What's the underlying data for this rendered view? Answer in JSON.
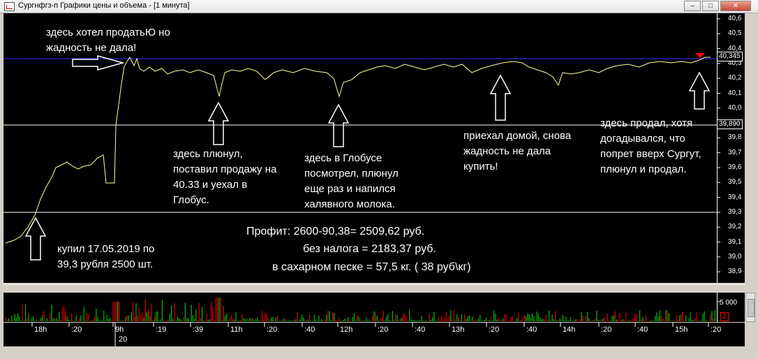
{
  "window": {
    "title": "Сургнфгз-п Графики цены и объема - [1 минута]",
    "buttons": [
      "–",
      "□",
      "✕"
    ]
  },
  "price_axis": {
    "ticks": [
      "40,6",
      "40,5",
      "40,4",
      "40,3",
      "40,2",
      "40,1",
      "40,0",
      "39,9",
      "39,8",
      "39,7",
      "39,6",
      "39,5",
      "39,4",
      "39,3",
      "39,2",
      "39,1",
      "39,0",
      "38,9"
    ],
    "current_price": "40,345",
    "marked_price": "39,890"
  },
  "volume_axis": {
    "ticks": [
      "5 000"
    ],
    "marker": "2"
  },
  "time_axis": {
    "labels": [
      "18h",
      ":20",
      "9h",
      ":19",
      ":39",
      "11h",
      ":20",
      ":40",
      "12h",
      ":20",
      ":40",
      "13h",
      ":20",
      ":40",
      "14h",
      ":20",
      ":40",
      "15h",
      ":20"
    ],
    "date": "20"
  },
  "annotations": {
    "sell_wish": "здесь хотел продатьЮ но\nжадность не дала!",
    "spit_sale": "здесь плюнул,\nпоставил продажу на\n40.33 и уехал в\nГлобус.",
    "globus": "здесь в Глобусе\nпосмотрел, плюнул\nеще раз и напился\nхалявного молока.",
    "home": "приехал домой, снова\nжадность не дала\nкупить!",
    "sold": "здесь продал, хотя\nдогадывался, что\nпопрет вверх Сургут,\nплюнул и продал.",
    "bought": "купил 17.05.2019 по\n39,3 рубля 2500 шт."
  },
  "profit": {
    "line1": "Профит:    2600-90,38=   2509,62 руб.",
    "line2": "без налога   =   2183,37 руб.",
    "line3": "в сахарном песке =  57,5 кг.    ( 38 руб\\кг)"
  },
  "colors": {
    "price_line": "#ffff99",
    "grid_blue": "#2020c0",
    "vol_green": "#00c000",
    "vol_red": "#e00000",
    "marker_red": "#ff0000"
  }
}
